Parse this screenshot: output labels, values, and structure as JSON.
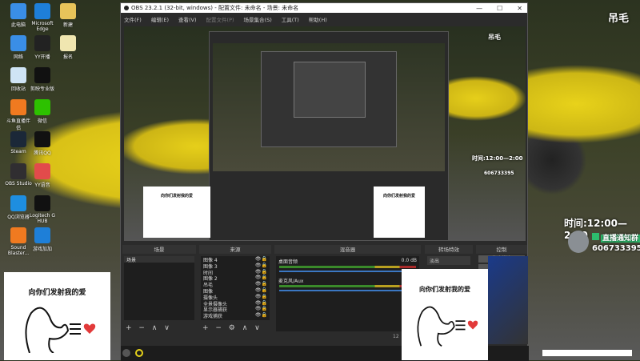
{
  "desktop": {
    "icons": [
      {
        "label": "此电脑",
        "color": "#3a8ee6"
      },
      {
        "label": "Microsoft Edge",
        "color": "#1e7fd8"
      },
      {
        "label": "新建",
        "color": "#e8c45a"
      },
      {
        "label": "网络",
        "color": "#3a8ee6"
      },
      {
        "label": "YY开播",
        "color": "#222"
      },
      {
        "label": "报名",
        "color": "#f0e6b0"
      },
      {
        "label": "回收站",
        "color": "#cfe4f5"
      },
      {
        "label": "剪映专业版",
        "color": "#111"
      },
      {
        "label": "",
        "color": "#888"
      },
      {
        "label": "斗鱼直播伴侣",
        "color": "#f07a20"
      },
      {
        "label": "微信",
        "color": "#2dc100"
      },
      {
        "label": "",
        "color": "#888"
      },
      {
        "label": "Steam",
        "color": "#1b2838"
      },
      {
        "label": "腾讯QQ",
        "color": "#111"
      },
      {
        "label": "",
        "color": "#888"
      },
      {
        "label": "OBS Studio",
        "color": "#302e31"
      },
      {
        "label": "YY语音",
        "color": "#e24b4b"
      },
      {
        "label": "",
        "color": "#888"
      },
      {
        "label": "QQ浏览器",
        "color": "#1e8ee0"
      },
      {
        "label": "Logitech G HUB",
        "color": "#111"
      },
      {
        "label": "",
        "color": "#888"
      },
      {
        "label": "Sound Blaster...",
        "color": "#f07a20"
      },
      {
        "label": "游戏加加",
        "color": "#1e7fd8"
      }
    ]
  },
  "obs": {
    "title": "OBS 23.2.1 (32-bit, windows) - 配置文件: 未命名 - 场景: 未命名",
    "window_buttons": [
      "—",
      "☐",
      "✕"
    ],
    "menu": [
      {
        "label": "文件(F)"
      },
      {
        "label": "编辑(E)"
      },
      {
        "label": "查看(V)"
      },
      {
        "label": "配置文件(P)",
        "disabled": true
      },
      {
        "label": "场景集合(S)"
      },
      {
        "label": "工具(T)"
      },
      {
        "label": "帮助(H)"
      }
    ],
    "scenes": {
      "title": "场景",
      "items": [
        "场景"
      ],
      "tools": "+ − ∧ ∨"
    },
    "sources": {
      "title": "来源",
      "items": [
        "图像 4",
        "图像 3",
        "时间",
        "图像 2",
        "吊毛",
        "图像",
        "摄像头",
        "全景摄像头",
        "显示器捕获",
        "游戏捕获"
      ],
      "tools": "+ − ⚙ ∧ ∨"
    },
    "mixer": {
      "title": "混音器",
      "channels": [
        {
          "name": "桌面音频",
          "db": "0.0 dB",
          "level": 0.3
        },
        {
          "name": "麦克风/Aux",
          "db": "",
          "level": 0.75
        }
      ]
    },
    "transitions": {
      "title": "转场特效",
      "selected": "淡出"
    },
    "controls": {
      "title": "控制",
      "buttons": [
        "停止推流",
        "开始录制"
      ]
    },
    "status": "12"
  },
  "overlay": {
    "name": "吊毛",
    "time": "时间:12:00—2:00",
    "group_label": "直播通知群",
    "group_number": "606733395"
  },
  "meme": {
    "caption": "向你们发射我的爱",
    "color_heart": "#e23a3a"
  }
}
